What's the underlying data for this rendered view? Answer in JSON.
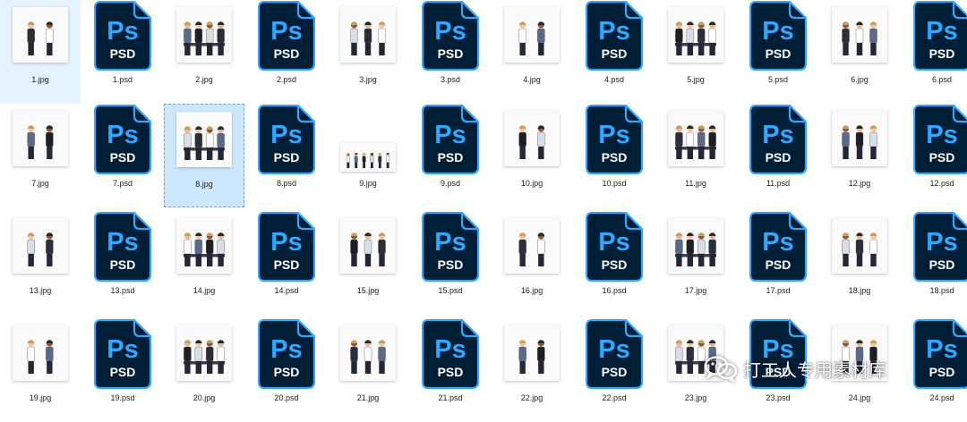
{
  "files": [
    {
      "name": "1.jpg",
      "type": "jpg",
      "state": "highlight"
    },
    {
      "name": "1.psd",
      "type": "psd"
    },
    {
      "name": "2.jpg",
      "type": "jpg"
    },
    {
      "name": "2.psd",
      "type": "psd"
    },
    {
      "name": "3.jpg",
      "type": "jpg"
    },
    {
      "name": "3.psd",
      "type": "psd"
    },
    {
      "name": "4.jpg",
      "type": "jpg"
    },
    {
      "name": "4.psd",
      "type": "psd"
    },
    {
      "name": "5.jpg",
      "type": "jpg"
    },
    {
      "name": "5.psd",
      "type": "psd"
    },
    {
      "name": "6.jpg",
      "type": "jpg"
    },
    {
      "name": "6.psd",
      "type": "psd"
    },
    {
      "name": "7.jpg",
      "type": "jpg"
    },
    {
      "name": "7.psd",
      "type": "psd"
    },
    {
      "name": "8.jpg",
      "type": "jpg",
      "state": "selected"
    },
    {
      "name": "8.psd",
      "type": "psd"
    },
    {
      "name": "9.jpg",
      "type": "jpg",
      "shape": "wide"
    },
    {
      "name": "9.psd",
      "type": "psd"
    },
    {
      "name": "10.jpg",
      "type": "jpg"
    },
    {
      "name": "10.psd",
      "type": "psd"
    },
    {
      "name": "11.jpg",
      "type": "jpg"
    },
    {
      "name": "11.psd",
      "type": "psd"
    },
    {
      "name": "12.jpg",
      "type": "jpg"
    },
    {
      "name": "12.psd",
      "type": "psd"
    },
    {
      "name": "13.jpg",
      "type": "jpg"
    },
    {
      "name": "13.psd",
      "type": "psd"
    },
    {
      "name": "14.jpg",
      "type": "jpg"
    },
    {
      "name": "14.psd",
      "type": "psd"
    },
    {
      "name": "15.jpg",
      "type": "jpg"
    },
    {
      "name": "15.psd",
      "type": "psd"
    },
    {
      "name": "16.jpg",
      "type": "jpg"
    },
    {
      "name": "16.psd",
      "type": "psd"
    },
    {
      "name": "17.jpg",
      "type": "jpg"
    },
    {
      "name": "17.psd",
      "type": "psd"
    },
    {
      "name": "18.jpg",
      "type": "jpg"
    },
    {
      "name": "18.psd",
      "type": "psd"
    },
    {
      "name": "19.jpg",
      "type": "jpg"
    },
    {
      "name": "19.psd",
      "type": "psd"
    },
    {
      "name": "20.jpg",
      "type": "jpg"
    },
    {
      "name": "20.psd",
      "type": "psd"
    },
    {
      "name": "21.jpg",
      "type": "jpg"
    },
    {
      "name": "21.psd",
      "type": "psd"
    },
    {
      "name": "22.jpg",
      "type": "jpg"
    },
    {
      "name": "22.psd",
      "type": "psd"
    },
    {
      "name": "23.jpg",
      "type": "jpg"
    },
    {
      "name": "23.psd",
      "type": "psd"
    },
    {
      "name": "24.jpg",
      "type": "jpg"
    },
    {
      "name": "24.psd",
      "type": "psd"
    }
  ],
  "psd_icon": {
    "logo": "Ps",
    "label": "PSD",
    "bg": "#001e36",
    "accent": "#31a8ff",
    "text": "#ffffff",
    "icon": "photoshop-file-icon"
  },
  "thumbnail_icon": "illustration-thumbnail",
  "watermark": {
    "text": "打工人专用素材库",
    "icon": "wechat-icon"
  },
  "colors": {
    "selected_bg": "#cce8ff",
    "highlight_bg": "#e5f3ff"
  }
}
